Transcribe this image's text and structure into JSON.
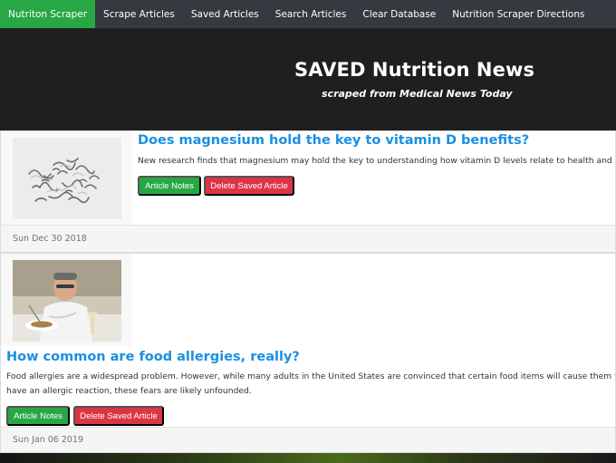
{
  "nav": {
    "brand": "Nutriton Scraper",
    "items": [
      {
        "label": "Scrape Articles"
      },
      {
        "label": "Saved Articles"
      },
      {
        "label": "Search Articles"
      },
      {
        "label": "Clear Database"
      },
      {
        "label": "Nutrition Scraper Directions"
      }
    ]
  },
  "hero": {
    "title": "SAVED Nutrition News",
    "subtitle": "scraped from Medical News Today"
  },
  "articles": [
    {
      "headline": "Does magnesium hold the key to vitamin D benefits?",
      "summary": "New research finds that magnesium may hold the key to understanding how vitamin D levels relate to health and disease.",
      "notes_label": "Article Notes",
      "delete_label": "Delete Saved Article",
      "date": "Sun Dec 30 2018"
    },
    {
      "headline": "How common are food allergies, really?",
      "summary": "Food allergies are a widespread problem. However, while many adults in the United States are convinced that certain food items will cause them to have an allergic reaction, these fears are likely unfounded.",
      "notes_label": "Article Notes",
      "delete_label": "Delete Saved Article",
      "date": "Sun Jan 06 2019"
    }
  ],
  "colors": {
    "brand_green": "#28a745",
    "danger_red": "#dc3545",
    "link_blue": "#1a8fe3",
    "navbar": "#343a40",
    "hero_bg": "#1f1f1f"
  }
}
